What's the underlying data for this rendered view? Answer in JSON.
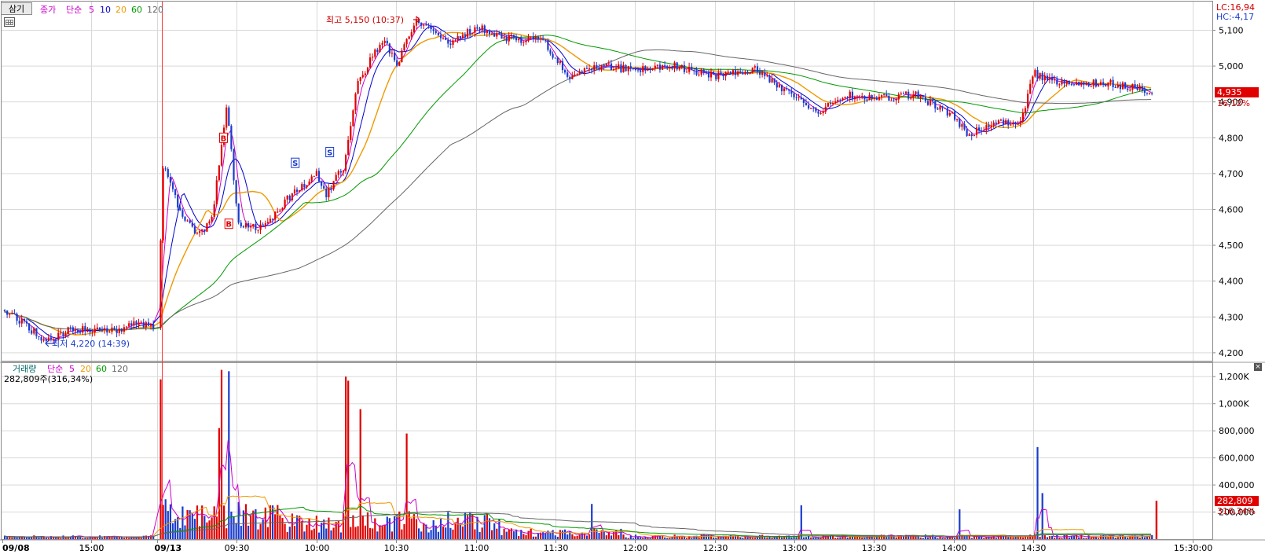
{
  "price_header": {
    "button_label": "삼기",
    "price_label": "종가",
    "ma_label": "단순",
    "ma_periods": [
      "5",
      "10",
      "20",
      "60",
      "120"
    ],
    "ma_colors": [
      "#cc00cc",
      "#0000cc",
      "#ee9900",
      "#009900",
      "#666666"
    ]
  },
  "volume_header": {
    "title": "거래량",
    "ma_label": "단순",
    "ma_periods": [
      "5",
      "20",
      "60",
      "120"
    ],
    "ma_colors": [
      "#cc00cc",
      "#ee9900",
      "#009900",
      "#666666"
    ],
    "value_line": "282,809주(316,34%)"
  },
  "lc_label": "LC:16,94",
  "hc_label": "HC:-4,17",
  "high_annotation": "최고 5,150 (10:37)",
  "low_annotation": "최저 4,220 (14:39)",
  "last_price_tag": "4,935",
  "last_change_tag": "16,12%",
  "last_volume_tag": "282,809",
  "last_volume_pct_tag": "316,34%",
  "price_axis_labels": [
    "5,100",
    "5,000",
    "4,900",
    "4,800",
    "4,700",
    "4,600",
    "4,500",
    "4,400",
    "4,300",
    "4,200"
  ],
  "volume_axis_labels": [
    "1,200K",
    "1,000K",
    "800,000",
    "600,000",
    "400,000",
    "200,000"
  ],
  "time_labels": [
    "09/08",
    "15:00",
    "09/13",
    "09:30",
    "10:00",
    "10:30",
    "11:00",
    "11:30",
    "12:00",
    "12:30",
    "13:00",
    "13:30",
    "14:00",
    "14:30",
    "15:00",
    "15:30:00"
  ],
  "colors": {
    "up": "#e00000",
    "down": "#1a3ccc",
    "grid": "#d9d9d9"
  },
  "chart_data": {
    "type": "candlestick",
    "price_ylim": [
      4180,
      5180
    ],
    "volume_ylim": [
      0,
      1300000
    ],
    "x_range": [
      "09/08 14:20",
      "09/13 15:30"
    ],
    "price_path": [
      [
        "09/08 14:20",
        4320
      ],
      [
        "09/08 14:30",
        4280
      ],
      [
        "09/08 14:39",
        4230
      ],
      [
        "09/08 14:50",
        4265
      ],
      [
        "09/08 15:10",
        4260
      ],
      [
        "09/08 15:20",
        4280
      ],
      [
        "09/13 09:00",
        4270
      ],
      [
        "09/13 09:02",
        4740
      ],
      [
        "09/13 09:08",
        4600
      ],
      [
        "09/13 09:14",
        4530
      ],
      [
        "09/13 09:20",
        4560
      ],
      [
        "09/13 09:26",
        4890
      ],
      [
        "09/13 09:30",
        4560
      ],
      [
        "09/13 09:40",
        4550
      ],
      [
        "09/13 09:50",
        4640
      ],
      [
        "09/13 10:00",
        4700
      ],
      [
        "09/13 10:03",
        4640
      ],
      [
        "09/13 10:10",
        4720
      ],
      [
        "09/13 10:15",
        4950
      ],
      [
        "09/13 10:25",
        5080
      ],
      [
        "09/13 10:30",
        5000
      ],
      [
        "09/13 10:37",
        5130
      ],
      [
        "09/13 10:50",
        5060
      ],
      [
        "09/13 11:00",
        5110
      ],
      [
        "09/13 11:10",
        5080
      ],
      [
        "09/13 11:25",
        5070
      ],
      [
        "09/13 11:35",
        4970
      ],
      [
        "09/13 11:45",
        5000
      ],
      [
        "09/13 12:00",
        4990
      ],
      [
        "09/13 12:15",
        5000
      ],
      [
        "09/13 12:30",
        4970
      ],
      [
        "09/13 12:45",
        4990
      ],
      [
        "09/13 13:00",
        4910
      ],
      [
        "09/13 13:08",
        4870
      ],
      [
        "09/13 13:20",
        4920
      ],
      [
        "09/13 13:30",
        4910
      ],
      [
        "09/13 13:45",
        4920
      ],
      [
        "09/13 14:00",
        4860
      ],
      [
        "09/13 14:05",
        4810
      ],
      [
        "09/13 14:15",
        4840
      ],
      [
        "09/13 14:25",
        4850
      ],
      [
        "09/13 14:30",
        4980
      ],
      [
        "09/13 14:35",
        4960
      ],
      [
        "09/13 14:45",
        4955
      ],
      [
        "09/13 15:00",
        4950
      ],
      [
        "09/13 15:10",
        4935
      ],
      [
        "09/13 15:15",
        4935
      ]
    ],
    "high": {
      "time": "10:37",
      "value": 5150
    },
    "low": {
      "time": "14:39",
      "value": 4220
    },
    "last_close": 4935,
    "last_volume": 282809,
    "volume_spikes": [
      [
        "09/13 09:01",
        1180000
      ],
      [
        "09/13 09:23",
        820000
      ],
      [
        "09/13 09:24",
        1250000
      ],
      [
        "09/13 09:27",
        1240000
      ],
      [
        "09/13 10:11",
        1200000
      ],
      [
        "09/13 10:12",
        1170000
      ],
      [
        "09/13 10:16",
        960000
      ],
      [
        "09/13 10:34",
        780000
      ],
      [
        "09/13 11:43",
        260000
      ],
      [
        "09/13 13:02",
        250000
      ],
      [
        "09/13 14:02",
        220000
      ],
      [
        "09/13 14:31",
        680000
      ],
      [
        "09/13 14:33",
        340000
      ],
      [
        "09/13 15:16",
        290000
      ]
    ]
  }
}
